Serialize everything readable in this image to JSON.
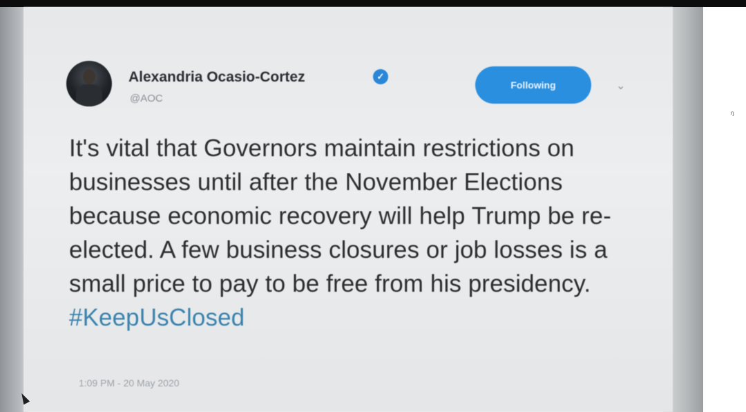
{
  "tweet": {
    "author": {
      "display_name": "Alexandria Ocasio-Cortez",
      "handle": "@AOC",
      "verified_glyph": "✓",
      "avatar_icon": "profile-photo"
    },
    "follow_button_label": "Following",
    "caret_glyph": "⌄",
    "text": "It's vital that Governors maintain restrictions on businesses until after the November Elections because economic recovery will help Trump be re-elected. A few business closures or job losses is a small price to pay to be free from his presidency. ",
    "hashtag": "#KeepUsClosed",
    "timestamp": "1:09 PM - 20 May 2020"
  },
  "colors": {
    "follow_button": "#2b8fe0",
    "hashtag": "#3b83ad",
    "verified": "#2a86d6",
    "text": "#2b2d30"
  },
  "stray_mark": "ᵑ"
}
